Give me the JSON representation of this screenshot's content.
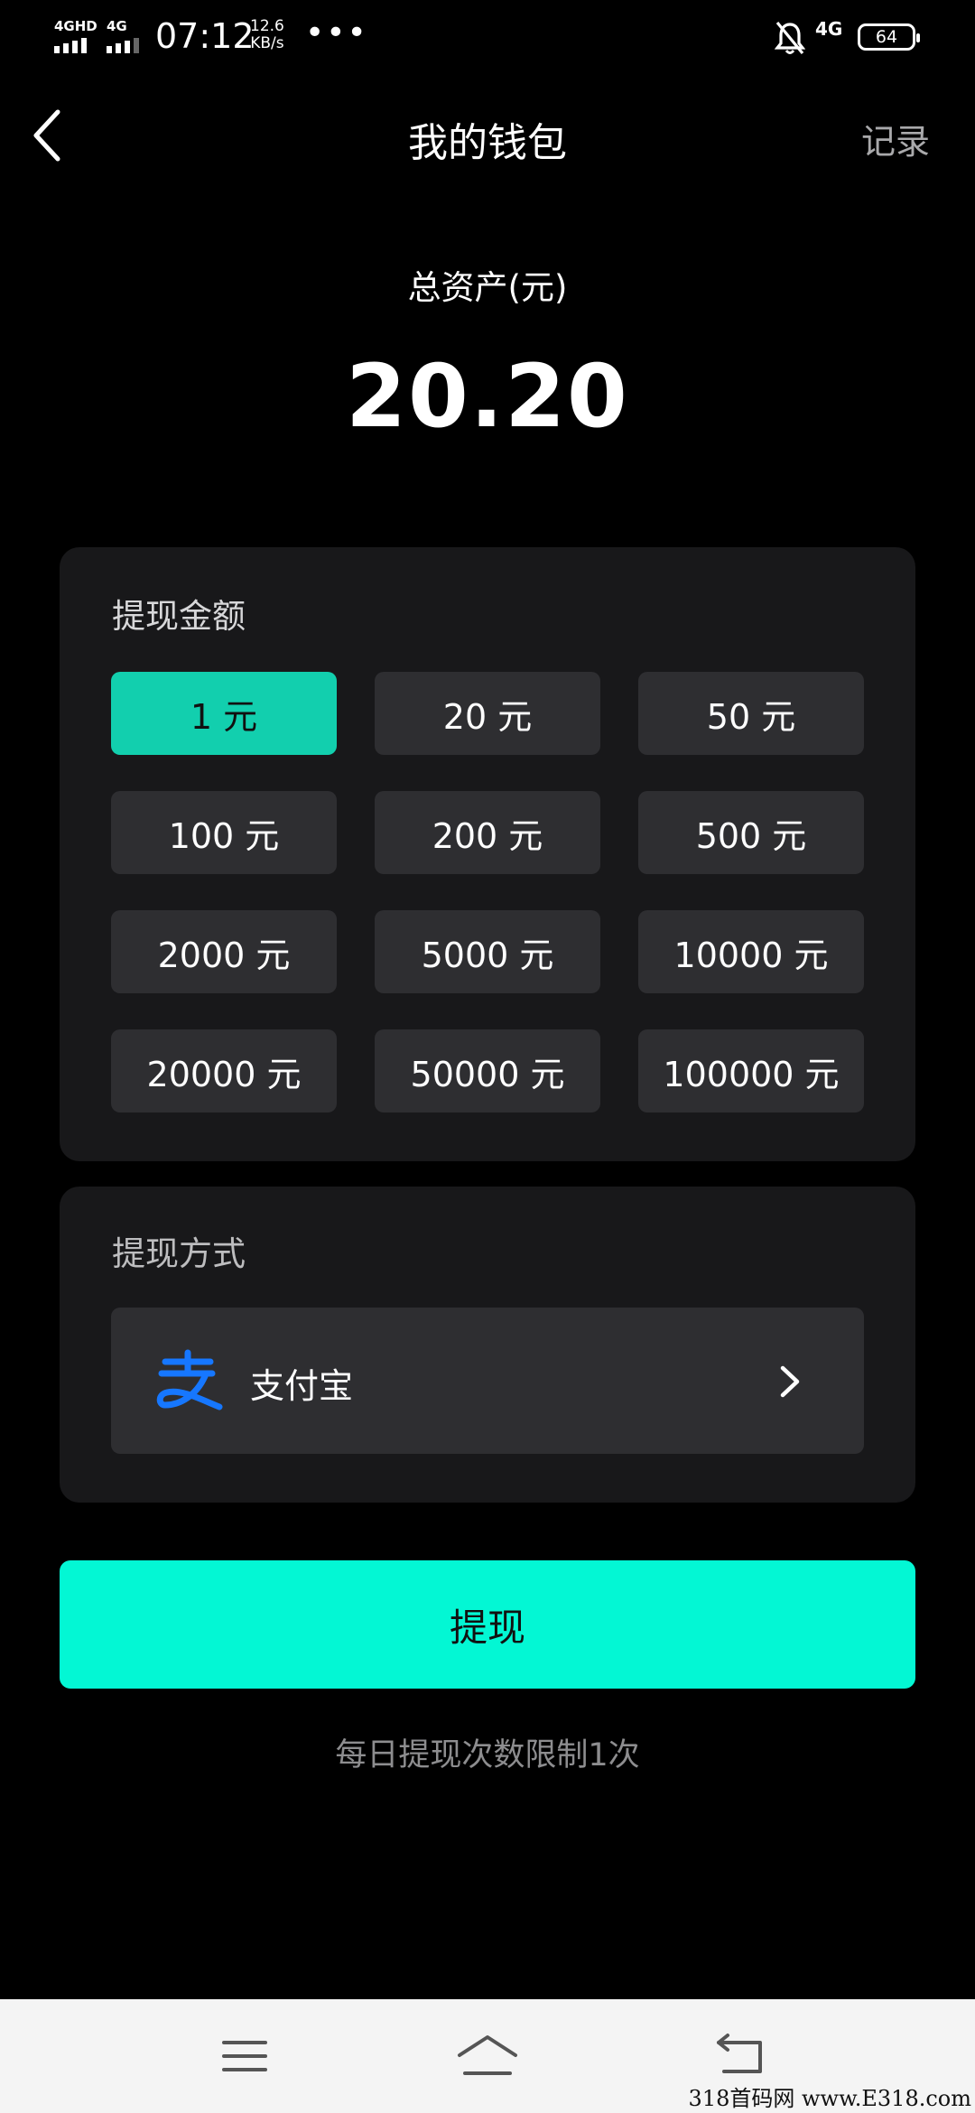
{
  "status_bar": {
    "network_1": "4GHD",
    "network_2": "4G",
    "time": "07:12",
    "speed_value": "12.6",
    "speed_unit": "KB/s",
    "more": "•••",
    "mobile_data": "4G",
    "battery": "64"
  },
  "header": {
    "title": "我的钱包",
    "records": "记录"
  },
  "balance": {
    "label": "总资产(元)",
    "value": "20.20"
  },
  "amount_section": {
    "title": "提现金额",
    "options": [
      "1 元",
      "20 元",
      "50 元",
      "100 元",
      "200 元",
      "500 元",
      "2000 元",
      "5000 元",
      "10000 元",
      "20000 元",
      "50000 元",
      "100000 元"
    ],
    "selected_index": 0
  },
  "method_section": {
    "title": "提现方式",
    "method_label": "支付宝"
  },
  "withdraw": {
    "button": "提现",
    "note": "每日提现次数限制1次"
  },
  "watermark": "318首码网 www.E318.com",
  "colors": {
    "accent": "#03f7d4",
    "selected": "#12cfae",
    "card": "#18181a",
    "option": "#2e2e31",
    "alipay": "#1677ff"
  }
}
